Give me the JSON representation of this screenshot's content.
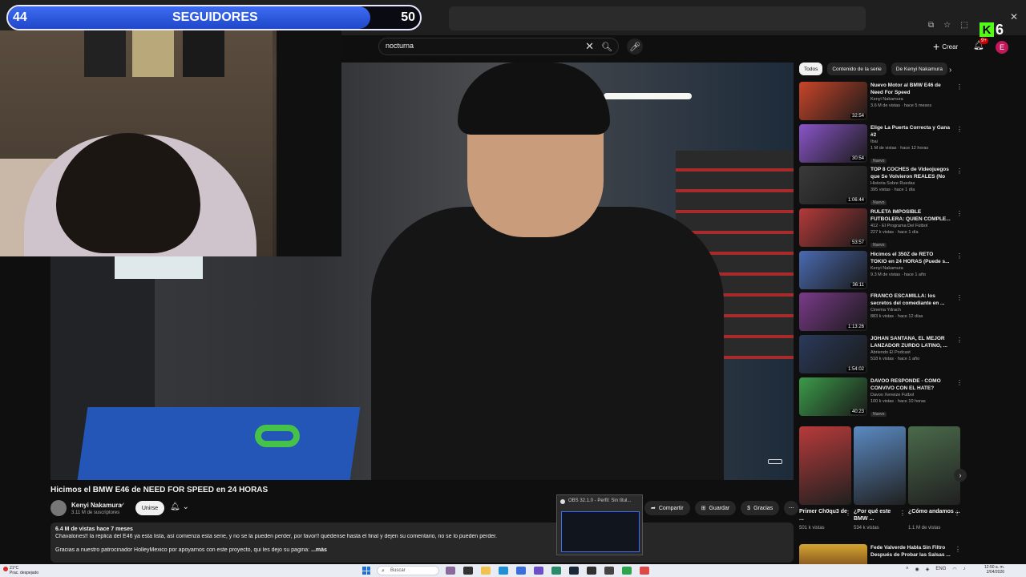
{
  "overlay": {
    "follower_goal": {
      "current": "44",
      "label": "SEGUIDORES",
      "target": "50",
      "progress": 0.88
    },
    "channel_badge": {
      "letter": "K",
      "number": "6"
    }
  },
  "header": {
    "search_value": "nocturna",
    "create_label": "Crear",
    "notifications_count": "9+",
    "avatar_letter": "E"
  },
  "video": {
    "title": "Hicimos el BMW E46 de NEED FOR SPEED en 24 HORAS",
    "channel": "Kenyi Nakamura",
    "subscribers": "3.11 M de suscriptores",
    "join_label": "Unirse",
    "actions": [
      {
        "label": "Compartir",
        "icon": "share-icon"
      },
      {
        "label": "Guardar",
        "icon": "save-icon"
      },
      {
        "label": "Gracias",
        "icon": "thanks-icon"
      }
    ],
    "description": {
      "meta": "6.4 M de vistas  hace 7 meses",
      "line1": "Chavalones!!  la replica del E46 ya esta lista, así comienza esta serie, y no se la pueden perder, por favor!! quédense hasta el final y dejen su comentario, no se lo pueden perder.",
      "line2": "Gracias a nuestro patrocinador HolleyMexico por apoyarnos con este proyecto, qui les dejo su pagina:",
      "more": "...más"
    }
  },
  "obs_popup": {
    "title": "OBS 32.1.0 - Perfil: Sin títul..."
  },
  "sidebar": {
    "chips": [
      "Todos",
      "Contenido de la serie",
      "De Kenyi Nakamura"
    ],
    "recommendations": [
      {
        "title": "Nuevo Motor al BMW E46 de Need For Speed",
        "channel": "Kenyi Nakamura",
        "meta": "3.6 M de vistas · hace 5 meses",
        "duration": "32:54",
        "badge": "",
        "thumb_color": "#c9452a"
      },
      {
        "title": "Elige La Puerta Correcta y Gana #2",
        "channel": "Ibai",
        "meta": "1 M de vistas · hace 12 horas",
        "duration": "30:54",
        "badge": "Nuevo",
        "thumb_color": "#8a55c9"
      },
      {
        "title": "TOP 8 COCHES de Videojuegos que Se Volvieron REALES (No ...",
        "channel": "Historia Sobre Ruedas",
        "meta": "395 vistas · hace 1 día",
        "duration": "1:06:44",
        "badge": "Nuevo",
        "thumb_color": "#3a3a3a"
      },
      {
        "title": "RULETA IMPOSIBLE FUTBOLERA: QUIEN COMPLE...",
        "channel": "412 - El Programa Del Fútbol",
        "meta": "227 k vistas · hace 1 día",
        "duration": "53:57",
        "badge": "Nuevo",
        "thumb_color": "#b33a3a"
      },
      {
        "title": "Hicimos el 350Z de RETO TOKIO en 24 HORAS (Puede s...",
        "channel": "Kenyi Nakamura",
        "meta": "9.3 M de vistas · hace 1 año",
        "duration": "36:11",
        "badge": "",
        "thumb_color": "#4a6ab0"
      },
      {
        "title": "FRANCO ESCAMILLA: los secretos del comediante en ...",
        "channel": "Cinema Ydrach",
        "meta": "883 k vistas · hace 12 días",
        "duration": "1:13:26",
        "badge": "",
        "thumb_color": "#7a3a8a"
      },
      {
        "title": "JOHAN SANTANA, EL MEJOR LANZADOR ZURDO LATINO, ...",
        "channel": "Abriendo El Podcast",
        "meta": "518 k vistas · hace 1 año",
        "duration": "1:54:02",
        "badge": "",
        "thumb_color": "#2a3a5a"
      },
      {
        "title": "DAVOO RESPONDE - COMO CONVIVO CON EL HATE?",
        "channel": "Davoo Xeneize Futbol",
        "meta": "100 k vistas · hace 10 horas",
        "duration": "40:23",
        "badge": "Nuevo",
        "thumb_color": "#3c9a4a"
      }
    ],
    "shorts": [
      {
        "title": "Primer Ch0qu3 de ...",
        "views": "501 k vistas",
        "thumb_color": "#b83a3a"
      },
      {
        "title": "¿Por qué este BMW ...",
        "views": "534 k vistas",
        "thumb_color": "#5a8ac2"
      },
      {
        "title": "¿Cómo andamos ...",
        "views": "1.1 M de vistas",
        "thumb_color": "#4a6a4a"
      }
    ],
    "last_recommendation": {
      "title": "Fede Valverde Habla Sin Filtro Después de Probar las Salsas ..."
    }
  },
  "taskbar": {
    "weather_temp": "21°C",
    "weather_desc": "Prac. despejado",
    "search_placeholder": "Buscar",
    "language": "ENG",
    "time": "12:50 a. m.",
    "date": "2/04/2026"
  }
}
